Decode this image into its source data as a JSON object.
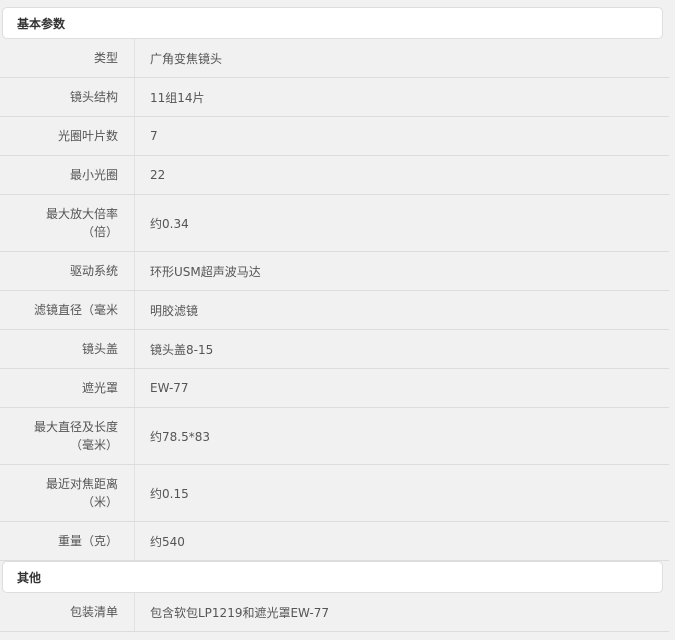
{
  "sections": {
    "basic": {
      "title": "基本参数",
      "rows": [
        {
          "label": "类型",
          "value": "广角变焦镜头"
        },
        {
          "label": "镜头结构",
          "value": "11组14片"
        },
        {
          "label": "光圈叶片数",
          "value": "7"
        },
        {
          "label": "最小光圈",
          "value": "22"
        },
        {
          "label": "最大放大倍率",
          "label2": "（倍）",
          "value": "约0.34"
        },
        {
          "label": "驱动系统",
          "value": "环形USM超声波马达"
        },
        {
          "label": "滤镜直径（毫米",
          "value": "明胶滤镜"
        },
        {
          "label": "镜头盖",
          "value": "镜头盖8-15"
        },
        {
          "label": "遮光罩",
          "value": "EW-77"
        },
        {
          "label": "最大直径及长度",
          "label2": "（毫米）",
          "value": "约78.5*83"
        },
        {
          "label": "最近对焦距离",
          "label2": "（米）",
          "value": "约0.15"
        },
        {
          "label": "重量（克）",
          "value": "约540"
        }
      ]
    },
    "other": {
      "title": "其他",
      "rows": [
        {
          "label": "包装清单",
          "value": "包含软包LP1219和遮光罩EW-77"
        }
      ]
    }
  }
}
